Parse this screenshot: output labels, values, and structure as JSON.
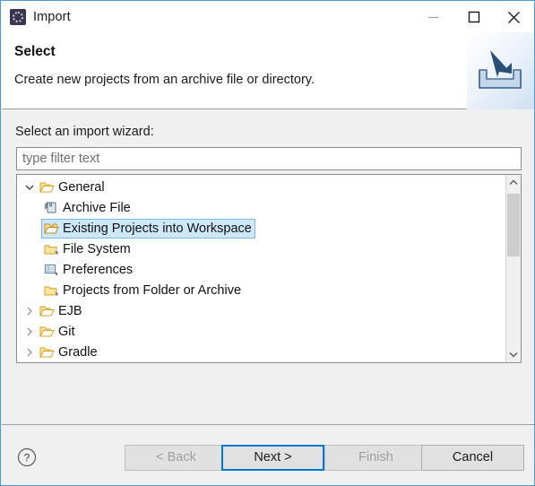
{
  "window": {
    "title": "Import",
    "app_icon": "eclipse-import-icon",
    "controls": [
      {
        "name": "minimize",
        "glyph": "minimize-icon"
      },
      {
        "name": "maximize",
        "glyph": "maximize-icon"
      },
      {
        "name": "close",
        "glyph": "close-icon"
      }
    ]
  },
  "banner": {
    "title": "Select",
    "description": "Create new projects from an archive file or directory.",
    "image": "import-tray-arrow-icon"
  },
  "body": {
    "label": "Select an import wizard:",
    "filter": {
      "value": "",
      "placeholder": "type filter text"
    },
    "tree": [
      {
        "label": "General",
        "indent": 0,
        "twisty": "expanded",
        "icon": "open-folder-icon",
        "selected": false
      },
      {
        "label": "Archive File",
        "indent": 1,
        "twisty": "none",
        "icon": "archive-file-icon",
        "selected": false
      },
      {
        "label": "Existing Projects into Workspace",
        "indent": 1,
        "twisty": "none",
        "icon": "existing-projects-icon",
        "selected": true
      },
      {
        "label": "File System",
        "indent": 1,
        "twisty": "none",
        "icon": "file-system-folder-icon",
        "selected": false
      },
      {
        "label": "Preferences",
        "indent": 1,
        "twisty": "none",
        "icon": "preferences-icon",
        "selected": false
      },
      {
        "label": "Projects from Folder or Archive",
        "indent": 1,
        "twisty": "none",
        "icon": "projects-folder-icon",
        "selected": false
      },
      {
        "label": "EJB",
        "indent": 0,
        "twisty": "collapsed",
        "icon": "open-folder-icon",
        "selected": false
      },
      {
        "label": "Git",
        "indent": 0,
        "twisty": "collapsed",
        "icon": "open-folder-icon",
        "selected": false
      },
      {
        "label": "Gradle",
        "indent": 0,
        "twisty": "collapsed",
        "icon": "open-folder-icon",
        "selected": false
      }
    ],
    "scrollbar": {
      "up_arrow": "chevron-up-icon",
      "down_arrow": "chevron-down-icon"
    }
  },
  "footer": {
    "help": "help-icon",
    "buttons": {
      "back": {
        "label": "< Back",
        "enabled": false,
        "focused": false
      },
      "next": {
        "label": "Next >",
        "enabled": true,
        "focused": true
      },
      "finish": {
        "label": "Finish",
        "enabled": false,
        "focused": false
      },
      "cancel": {
        "label": "Cancel",
        "enabled": true,
        "focused": false
      }
    }
  },
  "colors": {
    "selection_bg": "#cde8f9",
    "selection_border": "#7fb7e0",
    "focus_border": "#0078d7",
    "dialog_bg": "#f0f0f0",
    "window_border": "#4a9ad4"
  }
}
